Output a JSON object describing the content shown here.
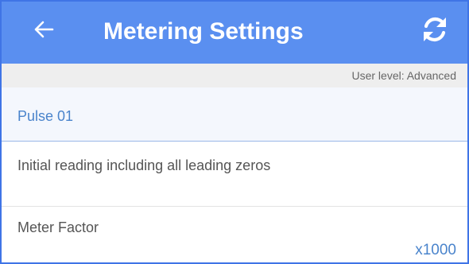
{
  "colors": {
    "app_bar": "#5a8ff0",
    "accent_text": "#4a84cc",
    "level_bar": "#eeeeee",
    "frame": "#3f74e6"
  },
  "app_bar": {
    "title": "Metering Settings",
    "back_icon": "arrow-left-icon",
    "refresh_icon": "refresh-icon"
  },
  "user_level": "User level: Advanced",
  "section": {
    "title": "Pulse 01"
  },
  "rows": [
    {
      "label": "Initial reading including all leading zeros",
      "value": ""
    },
    {
      "label": "Meter Factor",
      "value": "x1000"
    }
  ]
}
